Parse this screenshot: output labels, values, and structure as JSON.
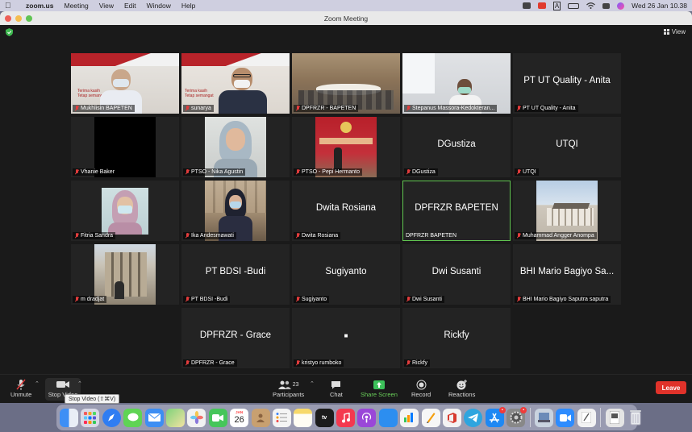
{
  "menubar": {
    "app_name": "zoom.us",
    "items": [
      "Meeting",
      "View",
      "Edit",
      "Window",
      "Help"
    ],
    "clock": "Wed 26 Jan  10.38",
    "status_icons": [
      "zoom-icon",
      "recording-icon",
      "text-input-icon",
      "battery-icon",
      "wifi-icon",
      "control-center-icon",
      "siri-icon"
    ]
  },
  "window": {
    "title": "Zoom Meeting",
    "view_label": "View"
  },
  "tiles": [
    {
      "name": "Mukhlisin BAPETEN",
      "video": true,
      "scene": "bapeten-banner"
    },
    {
      "name": "sunarya",
      "video": true,
      "scene": "bapeten-banner-2"
    },
    {
      "name": "DPFRZR - BAPETEN",
      "video": true,
      "scene": "conference-room"
    },
    {
      "name": "Stepanus Massora-Kedokteran...",
      "video": true,
      "scene": "office"
    },
    {
      "name": "PT UT Quality - Anita",
      "video": false,
      "display": "PT UT Quality - Anita"
    },
    {
      "name": "Vhanie Baker",
      "video": true,
      "scene": "black"
    },
    {
      "name": "PTSO - Nika Agustin",
      "video": true,
      "scene": "person-hijab"
    },
    {
      "name": "PTSO - Pepi Hermanto",
      "video": true,
      "scene": "stage-banner"
    },
    {
      "name": "DGustiza",
      "video": false,
      "display": "DGustiza"
    },
    {
      "name": "UTQI",
      "video": false,
      "display": "UTQI"
    },
    {
      "name": "Fitria Sandra",
      "video": true,
      "scene": "person-mask"
    },
    {
      "name": "Ika Andesmawati",
      "video": true,
      "scene": "street"
    },
    {
      "name": "Dwita Rosiana",
      "video": false,
      "display": "Dwita Rosiana"
    },
    {
      "name": "DPFRZR BAPETEN",
      "video": false,
      "display": "DPFRZR BAPETEN",
      "active": true
    },
    {
      "name": "Muhammad Angger Anompa",
      "video": true,
      "scene": "building"
    },
    {
      "name": "m dradjat",
      "video": true,
      "scene": "old-building"
    },
    {
      "name": "PT BDSI -Budi",
      "video": false,
      "display": "PT BDSI -Budi"
    },
    {
      "name": "Sugiyanto",
      "video": false,
      "display": "Sugiyanto"
    },
    {
      "name": "Dwi Susanti",
      "video": false,
      "display": "Dwi Susanti"
    },
    {
      "name": "BHI Mario Bagiyo Saputra saputra",
      "video": false,
      "display": "BHI Mario Bagiyo Sa..."
    },
    {
      "name": "DPFRZR - Grace",
      "video": false,
      "display": "DPFRZR - Grace"
    },
    {
      "name": "kristyo rumboko",
      "video": false,
      "display": "■"
    },
    {
      "name": "Rickfy",
      "video": false,
      "display": "Rickfy"
    }
  ],
  "banner_text": {
    "line1": "Terima kasih",
    "line2": "Tetap semangat"
  },
  "toolbar": {
    "unmute": "Unmute",
    "stop_video": "Stop Video",
    "participants": "Participants",
    "participants_count": "23",
    "chat": "Chat",
    "share_screen": "Share Screen",
    "record": "Record",
    "reactions": "Reactions",
    "leave": "Leave",
    "tooltip": "Stop Video (⇧⌘V)"
  },
  "colors": {
    "active_speaker": "#61c651",
    "leave": "#e0322a",
    "share_screen": "#6ad15a",
    "muted_mic": "#e23c3c"
  },
  "dock": {
    "calendar_day": "26",
    "calendar_month": "JAN",
    "apps": [
      {
        "name": "finder-icon",
        "color": "#3d8ff5"
      },
      {
        "name": "launchpad-icon",
        "color": "#d9d9e6"
      },
      {
        "name": "safari-icon",
        "color": "#2f7df2"
      },
      {
        "name": "messages-icon",
        "color": "#5fd454"
      },
      {
        "name": "mail-icon",
        "color": "#3d8ef3"
      },
      {
        "name": "maps-icon",
        "color": "#69c26a"
      },
      {
        "name": "photos-icon",
        "color": "#f2f2f2"
      },
      {
        "name": "facetime-icon",
        "color": "#46c65a"
      },
      {
        "name": "calendar-icon",
        "color": "#ffffff"
      },
      {
        "name": "contacts-icon",
        "color": "#c8a070"
      },
      {
        "name": "reminders-icon",
        "color": "#f4f4f4"
      },
      {
        "name": "notes-icon",
        "color": "#f7d96a"
      },
      {
        "name": "appletv-icon",
        "color": "#1c1c1c"
      },
      {
        "name": "music-icon",
        "color": "#f4394f"
      },
      {
        "name": "podcasts-icon",
        "color": "#9a47d8"
      },
      {
        "name": "appstore-alt-icon",
        "color": "#2c8ef0"
      },
      {
        "name": "numbers-icon",
        "color": "#f4f4f4"
      },
      {
        "name": "pages-icon",
        "color": "#f6f6f6"
      },
      {
        "name": "office-icon",
        "color": "#d73a2e"
      },
      {
        "name": "telegram-icon",
        "color": "#2ea5df"
      },
      {
        "name": "appstore-icon",
        "color": "#1e88f3"
      },
      {
        "name": "system-preferences-icon",
        "color": "#888888"
      },
      {
        "name": "preview-icon",
        "color": "#c9d3df"
      },
      {
        "name": "zoom-icon",
        "color": "#2d8cff"
      },
      {
        "name": "textedit-icon",
        "color": "#f3f3f3"
      },
      {
        "name": "document-icon",
        "color": "#e5e5e5"
      },
      {
        "name": "trash-icon",
        "color": "#cfd2d8"
      }
    ]
  }
}
